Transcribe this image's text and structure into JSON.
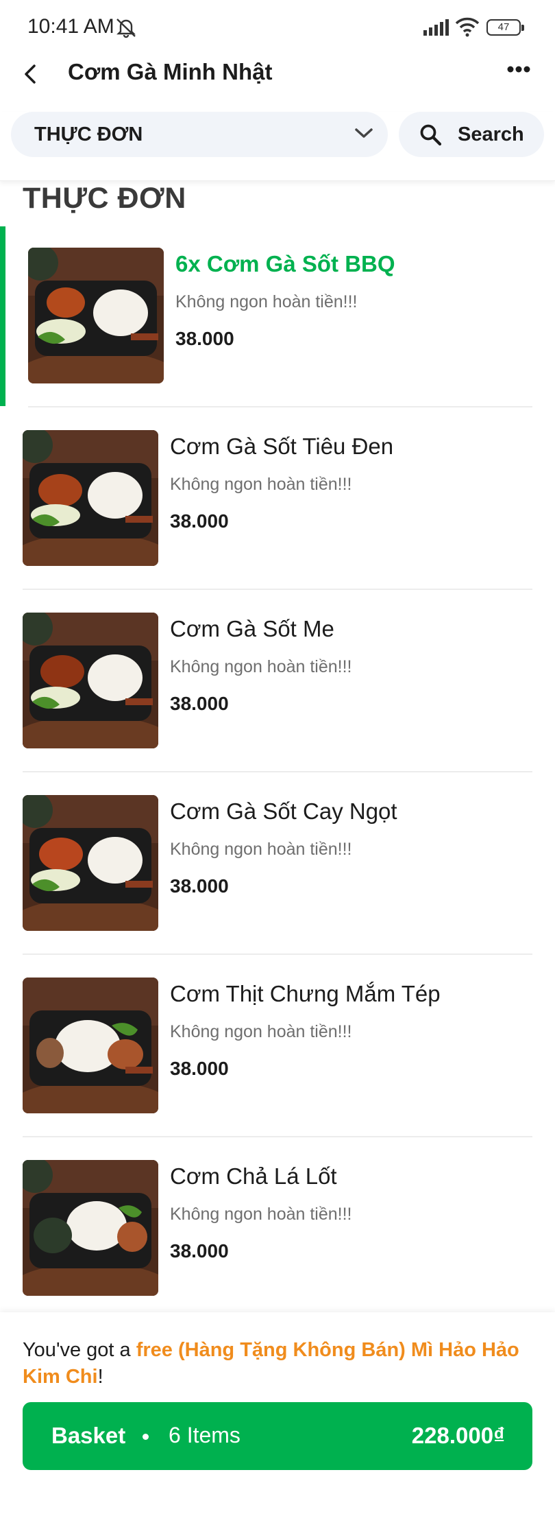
{
  "status_bar": {
    "time": "10:41 AM",
    "battery": "47"
  },
  "header": {
    "title": "Cơm Gà Minh Nhật"
  },
  "selector": {
    "category": "THỰC ĐƠN",
    "search_label": "Search"
  },
  "section": {
    "title": "THỰC ĐƠN"
  },
  "menu": {
    "items": [
      {
        "name": "6x Cơm Gà Sốt BBQ",
        "desc": "Không ngon hoàn tiền!!!",
        "price": "38.000",
        "selected": true
      },
      {
        "name": "Cơm Gà Sốt Tiêu Đen",
        "desc": "Không ngon hoàn tiền!!!",
        "price": "38.000",
        "selected": false
      },
      {
        "name": "Cơm Gà Sốt Me",
        "desc": "Không ngon hoàn tiền!!!",
        "price": "38.000",
        "selected": false
      },
      {
        "name": "Cơm Gà Sốt Cay Ngọt",
        "desc": "Không ngon hoàn tiền!!!",
        "price": "38.000",
        "selected": false
      },
      {
        "name": "Cơm Thịt Chưng Mắm Tép",
        "desc": "Không ngon hoàn tiền!!!",
        "price": "38.000",
        "selected": false
      },
      {
        "name": "Cơm Chả Lá Lốt",
        "desc": "Không ngon hoàn tiền!!!",
        "price": "38.000",
        "selected": false
      }
    ]
  },
  "promo": {
    "prefix": "You've got a ",
    "highlight": "free (Hàng Tặng Không Bán) Mì Hảo Hảo Kim Chi",
    "suffix": "!"
  },
  "basket": {
    "label": "Basket",
    "count": "6 Items",
    "total": "228.000₫"
  },
  "colors": {
    "accent": "#00b14f",
    "promo": "#f08c1d",
    "chip_bg": "#f1f4f9"
  }
}
